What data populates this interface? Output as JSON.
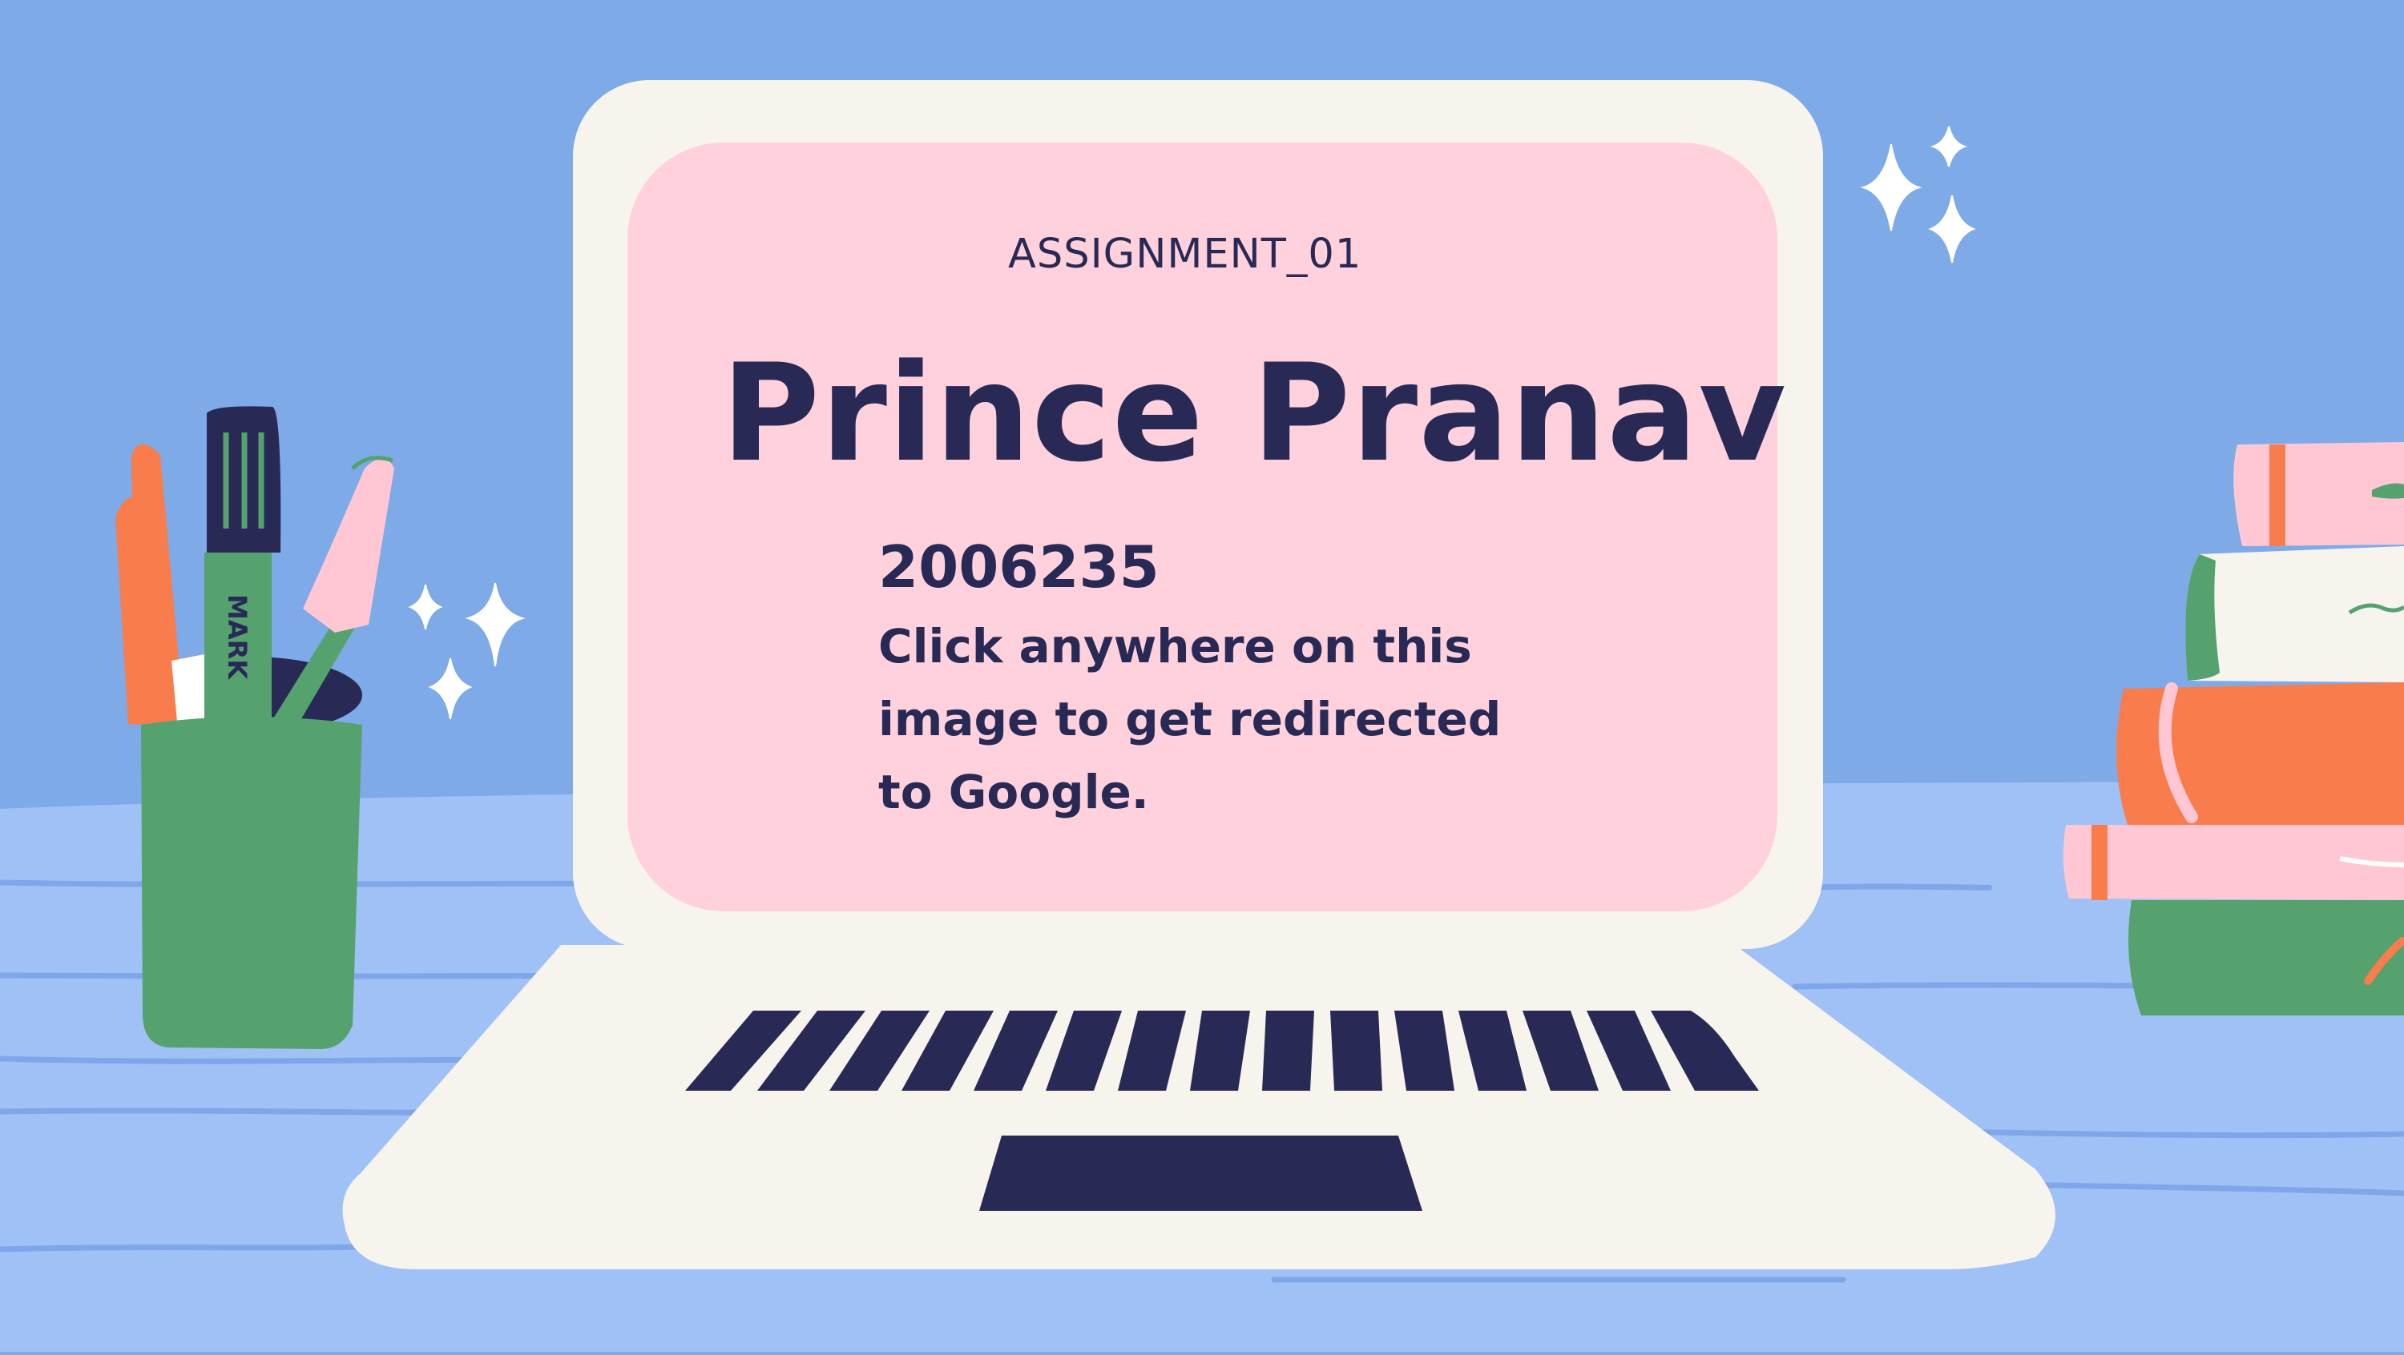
{
  "slide": {
    "assignment_label": "ASSIGNMENT_01",
    "name": "Prince Pranav",
    "student_id": "2006235",
    "instruction": "Click anywhere on this image to get redirected to Google.",
    "marker_label": "MARK"
  },
  "colors": {
    "background": "#7eaae8",
    "desk": "#a0c1f6",
    "laptop_body": "#f7f4ee",
    "screen": "#ffd1dc",
    "text": "#282a55",
    "green": "#55a26e",
    "orange": "#f97c4c",
    "pink": "#ffc7d3"
  },
  "icons": [
    "pen-cup-icon",
    "marker-icon",
    "sparkle-icon",
    "books-icon",
    "laptop-icon",
    "keyboard-icon",
    "trackpad-icon"
  ]
}
